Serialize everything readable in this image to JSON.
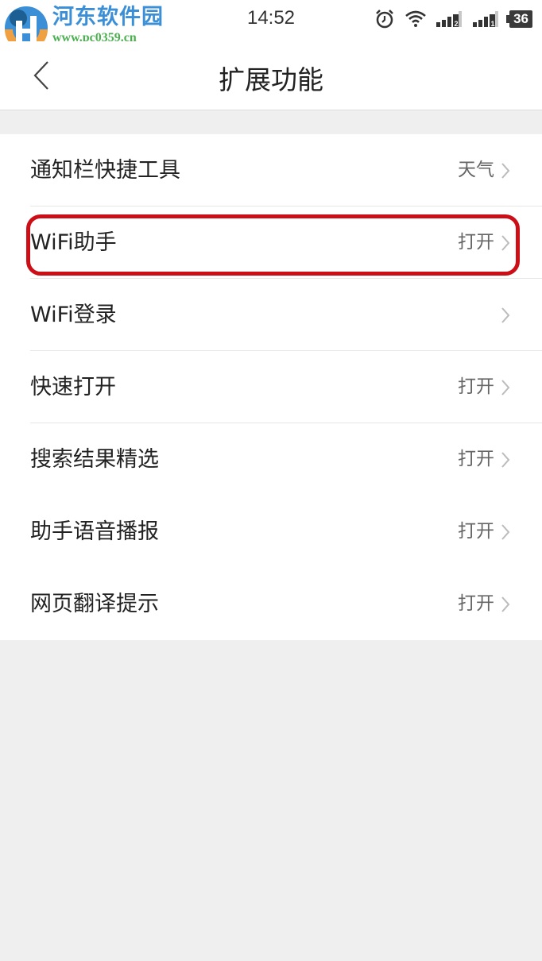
{
  "watermark": {
    "title": "河东软件园",
    "url": "www.pc0359.cn",
    "colors": {
      "title": "#3a8fd6",
      "url": "#4caf50",
      "logo_blue": "#3a8fd6",
      "logo_orange": "#f0a040"
    }
  },
  "status_bar": {
    "time": "14:52",
    "icons": [
      "alarm-icon",
      "wifi-icon",
      "signal-sim2-icon",
      "signal-sim1-icon",
      "battery-icon"
    ],
    "sim2_label": "2",
    "sim1_label": "1",
    "battery_level": "36"
  },
  "nav": {
    "back_icon": "chevron-left-icon",
    "title": "扩展功能"
  },
  "settings": [
    {
      "label": "通知栏快捷工具",
      "value": "天气"
    },
    {
      "label": "WiFi助手",
      "value": "打开",
      "highlighted": true
    },
    {
      "label": "WiFi登录",
      "value": ""
    },
    {
      "label": "快速打开",
      "value": "打开"
    },
    {
      "label": "搜索结果精选",
      "value": "打开"
    },
    {
      "label": "助手语音播报",
      "value": "打开"
    },
    {
      "label": "网页翻译提示",
      "value": "打开"
    }
  ],
  "colors": {
    "highlight_border": "#cc0f17",
    "background": "#efefef",
    "row_background": "#ffffff"
  }
}
